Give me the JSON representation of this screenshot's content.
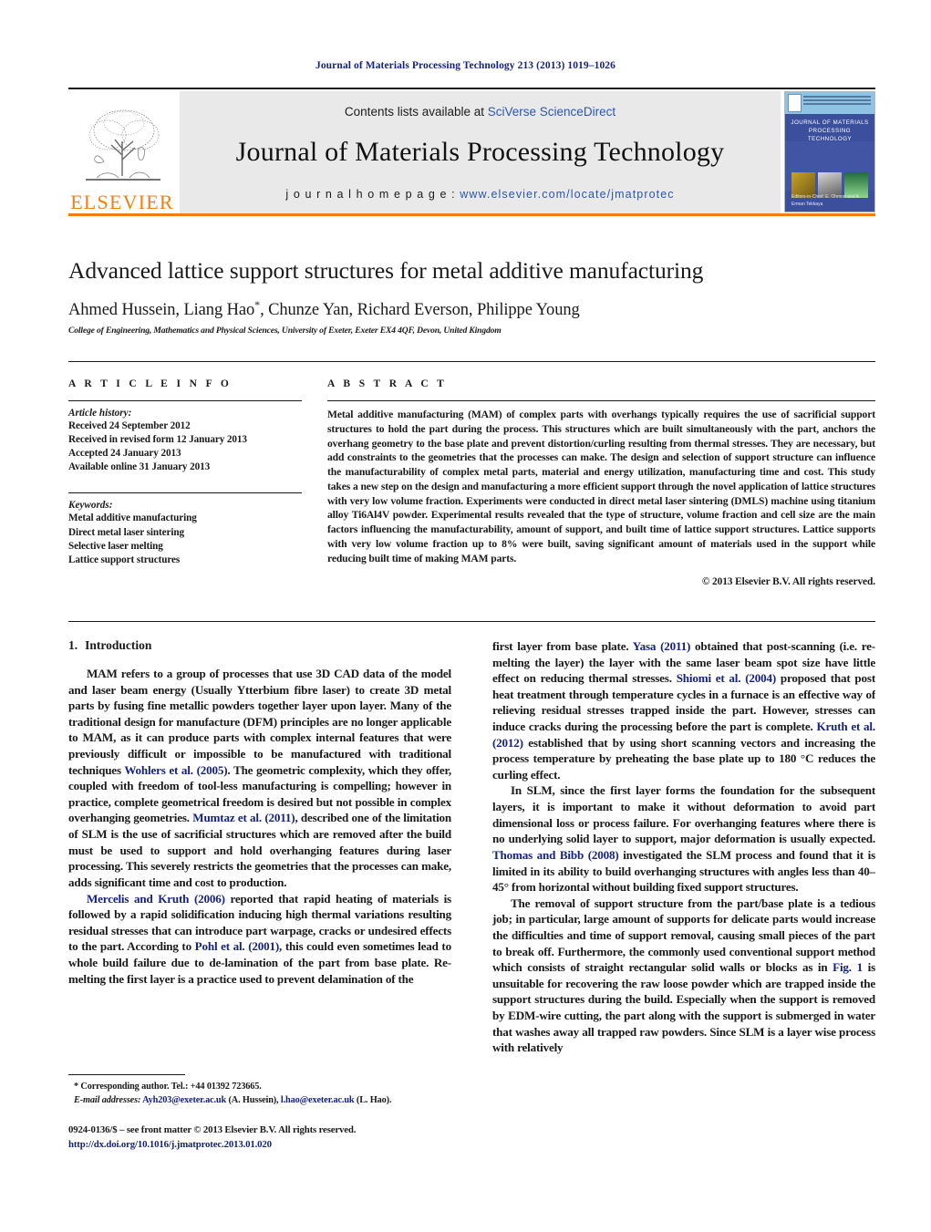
{
  "running_head": "Journal of Materials Processing Technology 213 (2013) 1019–1026",
  "masthead": {
    "contents_prefix": "Contents lists available at ",
    "contents_link": "SciVerse ScienceDirect",
    "journal_name": "Journal of Materials Processing Technology",
    "homepage_prefix": "j o u r n a l   h o m e p a g e :  ",
    "homepage_url": "www.elsevier.com/locate/jmatprotec",
    "publisher_logo_text": "ELSEVIER",
    "cover_title": "JOURNAL OF MATERIALS PROCESSING TECHNOLOGY",
    "cover_editors": "Editors-in-Chief: E. Ohmori and A. Erman Tekkaya",
    "accent_orange": "#f07f12",
    "link_blue": "#2b56b0"
  },
  "article": {
    "title": "Advanced lattice support structures for metal additive manufacturing",
    "authors": "Ahmed Hussein, Liang Hao",
    "authors_rest": ", Chunze Yan, Richard Everson, Philippe Young",
    "corresponding_marker": "*",
    "affiliation": "College of Engineering, Mathematics and Physical Sciences, University of Exeter, Exeter EX4 4QF, Devon, United Kingdom"
  },
  "article_info": {
    "heading": "A R T I C L E    I N F O",
    "history_label": "Article history:",
    "history": [
      "Received 24 September 2012",
      "Received in revised form 12 January 2013",
      "Accepted 24 January 2013",
      "Available online 31 January 2013"
    ],
    "keywords_label": "Keywords:",
    "keywords": [
      "Metal additive manufacturing",
      "Direct metal laser sintering",
      "Selective laser melting",
      "Lattice support structures"
    ]
  },
  "abstract": {
    "heading": "A B S T R A C T",
    "text": "Metal additive manufacturing (MAM) of complex parts with overhangs typically requires the use of sacrificial support structures to hold the part during the process. This structures which are built simultaneously with the part, anchors the overhang geometry to the base plate and prevent distortion/curling resulting from thermal stresses. They are necessary, but add constraints to the geometries that the processes can make. The design and selection of support structure can influence the manufacturability of complex metal parts, material and energy utilization, manufacturing time and cost. This study takes a new step on the design and manufacturing a more efficient support through the novel application of lattice structures with very low volume fraction. Experiments were conducted in direct metal laser sintering (DMLS) machine using titanium alloy Ti6Al4V powder. Experimental results revealed that the type of structure, volume fraction and cell size are the main factors influencing the manufacturability, amount of support, and built time of lattice support structures. Lattice supports with very low volume fraction up to 8% were built, saving significant amount of materials used in the support while reducing built time of making MAM parts.",
    "copyright": "© 2013 Elsevier B.V. All rights reserved."
  },
  "body": {
    "section_number": "1.",
    "section_title": "Introduction",
    "left_paragraphs": [
      {
        "segments": [
          {
            "t": "MAM refers to a group of processes that use 3D CAD data of the model and laser beam energy (Usually Ytterbium fibre laser) to create 3D metal parts by fusing fine metallic powders together layer upon layer. Many of the traditional design for manufacture (DFM) principles are no longer applicable to MAM, as it can produce parts with complex internal features that were previously difficult or impossible to be manufactured with traditional techniques ",
            "ref": false
          },
          {
            "t": "Wohlers et al. (2005)",
            "ref": true
          },
          {
            "t": ". The geometric complexity, which they offer, coupled with freedom of tool-less manufacturing is compelling; however in practice, complete geometrical freedom is desired but not possible in complex overhanging geometries. ",
            "ref": false
          },
          {
            "t": "Mumtaz et al. (2011)",
            "ref": true
          },
          {
            "t": ", described one of the limitation of SLM is the use of sacrificial structures which are removed after the build must be used to support and hold overhanging features during laser processing. This severely restricts the geometries that the processes can make, adds significant time and cost to production.",
            "ref": false
          }
        ]
      },
      {
        "segments": [
          {
            "t": "Mercelis and Kruth (2006)",
            "ref": true
          },
          {
            "t": " reported that rapid heating of materials is followed by a rapid solidification inducing high thermal variations resulting residual stresses that can introduce part warpage, cracks or undesired effects to the part. According to ",
            "ref": false
          },
          {
            "t": "Pohl et al. (2001)",
            "ref": true
          },
          {
            "t": ", this could even sometimes lead to whole build failure due to de-lamination of the part from base plate. Re-melting the first layer is a practice used to prevent delamination of the",
            "ref": false
          }
        ]
      }
    ],
    "right_paragraphs": [
      {
        "continued": true,
        "segments": [
          {
            "t": "first layer from base plate. ",
            "ref": false
          },
          {
            "t": "Yasa (2011)",
            "ref": true
          },
          {
            "t": " obtained that post-scanning (i.e. re-melting the layer) the layer with the same laser beam spot size have little effect on reducing thermal stresses. ",
            "ref": false
          },
          {
            "t": "Shiomi et al. (2004)",
            "ref": true
          },
          {
            "t": " proposed that post heat treatment through temperature cycles in a furnace is an effective way of relieving residual stresses trapped inside the part. However, stresses can induce cracks during the processing before the part is complete. ",
            "ref": false
          },
          {
            "t": "Kruth et al. (2012)",
            "ref": true
          },
          {
            "t": " established that by using short scanning vectors and increasing the process temperature by preheating the base plate up to 180 °C reduces the curling effect.",
            "ref": false
          }
        ]
      },
      {
        "segments": [
          {
            "t": "In SLM, since the first layer forms the foundation for the subsequent layers, it is important to make it without deformation to avoid part dimensional loss or process failure. For overhanging features where there is no underlying solid layer to support, major deformation is usually expected. ",
            "ref": false
          },
          {
            "t": "Thomas and Bibb (2008)",
            "ref": true
          },
          {
            "t": " investigated the SLM process and found that it is limited in its ability to build overhanging structures with angles less than 40–45° from horizontal without building fixed support structures.",
            "ref": false
          }
        ]
      },
      {
        "segments": [
          {
            "t": "The removal of support structure from the part/base plate is a tedious job; in particular, large amount of supports for delicate parts would increase the difficulties and time of support removal, causing small pieces of the part to break off. Furthermore, the commonly used conventional support method which consists of straight rectangular solid walls or blocks as in ",
            "ref": false
          },
          {
            "t": "Fig. 1",
            "ref": true
          },
          {
            "t": " is unsuitable for recovering the raw loose powder which are trapped inside the support structures during the build. Especially when the support is removed by EDM-wire cutting, the part along with the support is submerged in water that washes away all trapped raw powders. Since SLM is a layer wise process with relatively",
            "ref": false
          }
        ]
      }
    ]
  },
  "footnote": {
    "corresponding": "* Corresponding author. Tel.: +44 01392 723665.",
    "email_label": "E-mail addresses:",
    "email_1": "Ayh203@exeter.ac.uk",
    "email_1_owner": " (A. Hussein), ",
    "email_2": "l.hao@exeter.ac.uk",
    "email_2_owner": " (L. Hao)."
  },
  "colophon": {
    "issn_line": "0924-0136/$ – see front matter © 2013 Elsevier B.V. All rights reserved.",
    "doi": "http://dx.doi.org/10.1016/j.jmatprotec.2013.01.020"
  }
}
